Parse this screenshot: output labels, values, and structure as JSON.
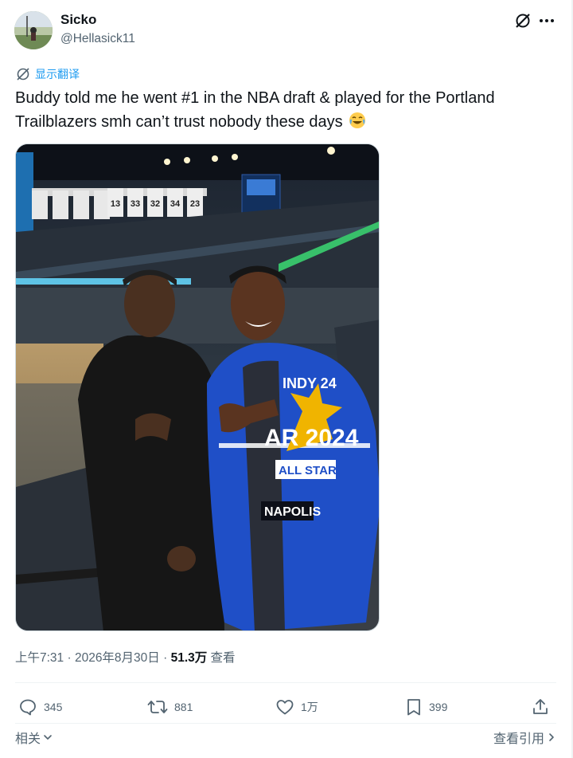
{
  "author": {
    "display_name": "Sicko",
    "handle": "@Hellasick11"
  },
  "translate_label": "显示翻译",
  "tweet": {
    "text": "Buddy told me he went #1 in the NBA draft & played for the Portland Trailblazers smh can’t trust nobody these days",
    "emoji": "joy-emoji"
  },
  "photo": {
    "banners": [
      "13",
      "33",
      "32",
      "34",
      "23"
    ],
    "jacket_lines": [
      "INDY 24",
      "AR 2024",
      "ALL STAR",
      "NAPOLIS"
    ]
  },
  "meta": {
    "time": "上午7:31",
    "sep1": " · ",
    "date": "2026年8月30日",
    "sep2": " · ",
    "views": "51.3万",
    "views_label": " 查看"
  },
  "actions": {
    "replies": "345",
    "retweets": "881",
    "likes": "1万",
    "bookmarks": "399"
  },
  "footer": {
    "related_label": "相关",
    "quotes_label": "查看引用"
  },
  "colors": {
    "text": "#0f1419",
    "secondary": "#536471",
    "link": "#1d9bf0",
    "jacket_blue": "#1f4fc7"
  },
  "icons": [
    "grok-icon",
    "more-icon",
    "translate-icon",
    "reply-icon",
    "retweet-icon",
    "like-icon",
    "bookmark-icon",
    "share-icon",
    "chevron-down-icon",
    "chevron-right-icon"
  ]
}
